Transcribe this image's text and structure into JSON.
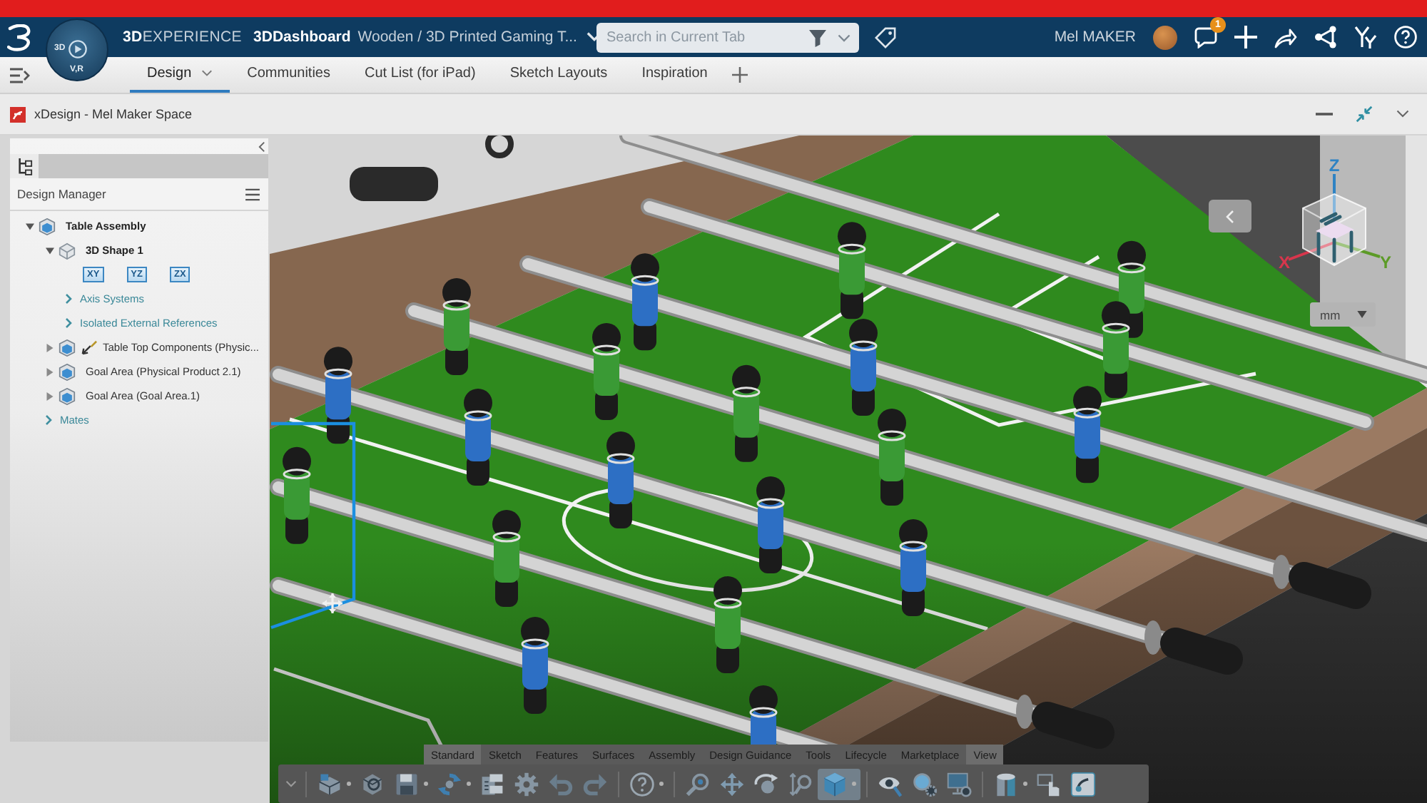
{
  "header": {
    "platform": "**3D**EXPERIENCE",
    "app": "3DDashboard",
    "dashboard": "Wooden / 3D Printed Gaming T...",
    "compass_labels": [
      "3D",
      "V,R"
    ],
    "search": {
      "placeholder": "Search in Current Tab"
    },
    "user": "Mel MAKER",
    "notification_count": "1"
  },
  "tabs": [
    {
      "label": "Design",
      "selected": true,
      "menu": true
    },
    {
      "label": "Communities",
      "selected": false,
      "menu": false
    },
    {
      "label": "Cut List (for iPad)",
      "selected": false,
      "menu": false
    },
    {
      "label": "Sketch Layouts",
      "selected": false,
      "menu": false
    },
    {
      "label": "Inspiration",
      "selected": false,
      "menu": false
    }
  ],
  "app_header": {
    "title": "xDesign - Mel Maker Space"
  },
  "design_manager": {
    "title": "Design Manager",
    "tree": [
      {
        "kind": "assembly",
        "label": "Table Assembly",
        "active": true,
        "expanded": true,
        "edited": false,
        "children": [
          {
            "kind": "shape",
            "label": "3D Shape 1",
            "active": true,
            "expanded": true,
            "edited": false,
            "children": [
              {
                "kind": "planes",
                "planes": [
                  "XY",
                  "YZ",
                  "ZX"
                ]
              },
              {
                "kind": "folder",
                "label": "Axis Systems",
                "expanded": false
              },
              {
                "kind": "folder",
                "label": "Isolated External References",
                "expanded": false
              }
            ]
          },
          {
            "kind": "assembly",
            "label": "Table Top Components (Physic...",
            "active": false,
            "expanded": false,
            "edited": true
          },
          {
            "kind": "assembly",
            "label": "Goal Area (Physical Product 2.1)",
            "active": false,
            "expanded": false,
            "edited": false
          },
          {
            "kind": "assembly",
            "label": "Goal Area (Goal Area.1)",
            "active": false,
            "expanded": false,
            "edited": false
          },
          {
            "kind": "folder",
            "label": "Mates",
            "expanded": false
          }
        ]
      }
    ]
  },
  "viewport": {
    "view_cube_axes": [
      {
        "label": "Z",
        "color": "#2f83c4"
      },
      {
        "label": "X",
        "color": "#d8364c"
      },
      {
        "label": "Y",
        "color": "#5c9b27"
      }
    ],
    "units": "mm"
  },
  "action_bar": {
    "tabs": [
      {
        "label": "Standard",
        "selected": true
      },
      {
        "label": "Sketch",
        "selected": false
      },
      {
        "label": "Features",
        "selected": false
      },
      {
        "label": "Surfaces",
        "selected": false
      },
      {
        "label": "Assembly",
        "selected": false
      },
      {
        "label": "Design Guidance",
        "selected": false
      },
      {
        "label": "Tools",
        "selected": false
      },
      {
        "label": "Lifecycle",
        "selected": false
      },
      {
        "label": "Marketplace",
        "selected": false
      },
      {
        "label": "View",
        "selected": true
      }
    ],
    "groups": [
      [
        {
          "kind": "part",
          "dropdown": true,
          "selected": false
        },
        {
          "kind": "shape",
          "dropdown": false,
          "selected": false
        },
        {
          "kind": "save",
          "dropdown": true,
          "selected": false
        },
        {
          "kind": "update",
          "dropdown": true,
          "selected": false
        },
        {
          "kind": "properties",
          "dropdown": false,
          "selected": false
        },
        {
          "kind": "settings",
          "dropdown": false,
          "selected": false
        },
        {
          "kind": "undo",
          "dropdown": false,
          "selected": false
        },
        {
          "kind": "redo",
          "dropdown": false,
          "selected": false
        }
      ],
      [
        {
          "kind": "help",
          "dropdown": true,
          "selected": false
        }
      ],
      [
        {
          "kind": "zoom",
          "dropdown": false,
          "selected": false
        },
        {
          "kind": "pan",
          "dropdown": false,
          "selected": false
        },
        {
          "kind": "rotate",
          "dropdown": false,
          "selected": false
        },
        {
          "kind": "fit",
          "dropdown": false,
          "selected": false
        },
        {
          "kind": "cube",
          "dropdown": true,
          "selected": true
        }
      ],
      [
        {
          "kind": "visibility",
          "dropdown": false,
          "selected": false
        },
        {
          "kind": "inspect",
          "dropdown": false,
          "selected": false
        },
        {
          "kind": "display",
          "dropdown": false,
          "selected": false
        }
      ],
      [
        {
          "kind": "section",
          "dropdown": true,
          "selected": false
        },
        {
          "kind": "pick",
          "dropdown": false,
          "selected": false
        },
        {
          "kind": "brush",
          "dropdown": false,
          "selected": false
        }
      ]
    ]
  }
}
